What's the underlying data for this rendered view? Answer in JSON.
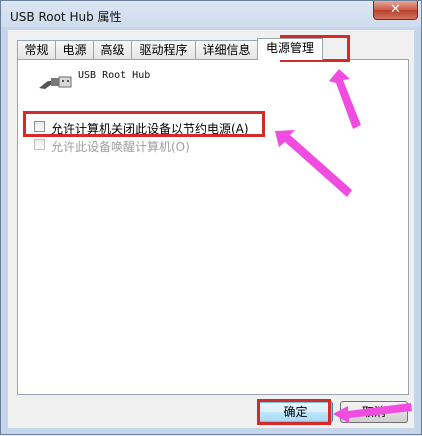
{
  "window": {
    "title": "USB Root Hub 属性",
    "close_label": "✕"
  },
  "tabs": [
    {
      "label": "常规"
    },
    {
      "label": "电源"
    },
    {
      "label": "高级"
    },
    {
      "label": "驱动程序"
    },
    {
      "label": "详细信息"
    },
    {
      "label": "电源管理",
      "active": true
    }
  ],
  "device": {
    "name": "USB Root Hub",
    "icon": "usb-plug-icon"
  },
  "options": {
    "allow_turn_off": {
      "label": "允许计算机关闭此设备以节约电源(A)",
      "checked": false
    },
    "allow_wake": {
      "label": "允许此设备唤醒计算机(O)",
      "checked": false,
      "enabled": false
    }
  },
  "buttons": {
    "ok": "确定",
    "cancel": "取消"
  },
  "annotations": {
    "highlight_color": "#d52a2a",
    "arrow_color": "#f04ce0"
  }
}
